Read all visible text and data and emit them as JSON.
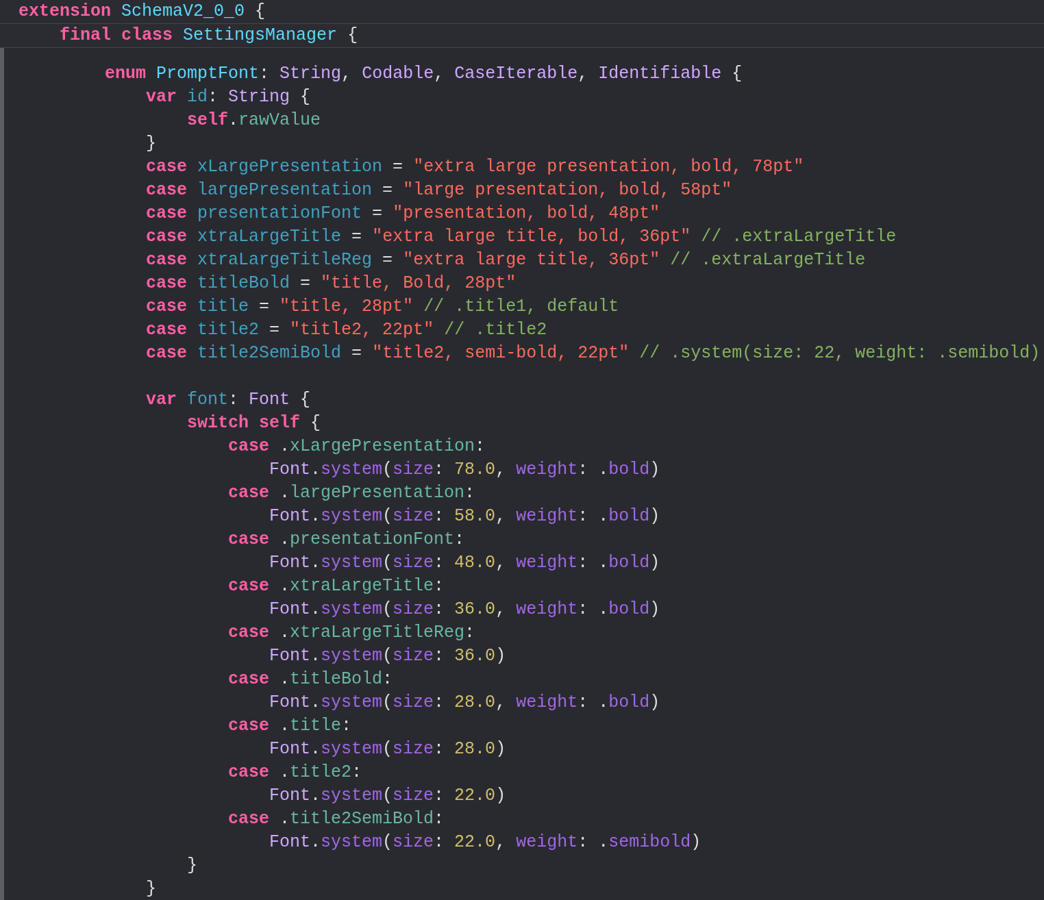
{
  "sticky_header": [
    {
      "kind": "code",
      "words": [
        [
          {
            "kind": "keyword",
            "text": "extension"
          }
        ],
        [
          {
            "kind": "decl",
            "text": "SchemaV2_0_0"
          }
        ],
        [
          {
            "kind": "punct",
            "text": "{"
          }
        ]
      ],
      "children": [
        {
          "kind": "code",
          "words": [
            [
              {
                "kind": "keyword",
                "text": "final"
              }
            ],
            [
              {
                "kind": "keyword",
                "text": "class"
              }
            ],
            [
              {
                "kind": "decl",
                "text": "SettingsManager"
              }
            ],
            [
              {
                "kind": "punct",
                "text": "{"
              }
            ]
          ]
        }
      ]
    }
  ],
  "code_lines": [
    {
      "kind": "code",
      "words": [
        [
          {
            "kind": "keyword",
            "text": "enum"
          }
        ],
        [
          {
            "kind": "decl",
            "text": "PromptFont"
          },
          {
            "kind": "punct",
            "text": ":"
          }
        ],
        [
          {
            "kind": "type",
            "text": "String"
          },
          {
            "kind": "punct",
            "text": ","
          }
        ],
        [
          {
            "kind": "type",
            "text": "Codable"
          },
          {
            "kind": "punct",
            "text": ","
          }
        ],
        [
          {
            "kind": "type",
            "text": "CaseIterable"
          },
          {
            "kind": "punct",
            "text": ","
          }
        ],
        [
          {
            "kind": "type",
            "text": "Identifiable"
          }
        ],
        [
          {
            "kind": "punct",
            "text": "{"
          }
        ]
      ],
      "children": [
        {
          "kind": "code",
          "words": [
            [
              {
                "kind": "keyword",
                "text": "var"
              }
            ],
            [
              {
                "kind": "ident",
                "text": "id"
              },
              {
                "kind": "punct",
                "text": ":"
              }
            ],
            [
              {
                "kind": "type",
                "text": "String"
              }
            ],
            [
              {
                "kind": "punct",
                "text": "{"
              }
            ]
          ],
          "children": [
            {
              "kind": "code",
              "words": [
                [
                  {
                    "kind": "keyword",
                    "text": "self"
                  },
                  {
                    "kind": "punct",
                    "text": "."
                  },
                  {
                    "kind": "member",
                    "text": "rawValue"
                  }
                ]
              ]
            }
          ]
        },
        {
          "kind": "code",
          "words": [
            [
              {
                "kind": "punct",
                "text": "}"
              }
            ]
          ]
        },
        {
          "kind": "code",
          "words": [
            [
              {
                "kind": "keyword",
                "text": "case"
              }
            ],
            [
              {
                "kind": "ident",
                "text": "xLargePresentation"
              }
            ],
            [
              {
                "kind": "punct",
                "text": "="
              }
            ],
            [
              {
                "kind": "string",
                "text": "\"extra large presentation, bold, 78pt\""
              }
            ]
          ]
        },
        {
          "kind": "code",
          "words": [
            [
              {
                "kind": "keyword",
                "text": "case"
              }
            ],
            [
              {
                "kind": "ident",
                "text": "largePresentation"
              }
            ],
            [
              {
                "kind": "punct",
                "text": "="
              }
            ],
            [
              {
                "kind": "string",
                "text": "\"large presentation, bold, 58pt\""
              }
            ]
          ]
        },
        {
          "kind": "code",
          "words": [
            [
              {
                "kind": "keyword",
                "text": "case"
              }
            ],
            [
              {
                "kind": "ident",
                "text": "presentationFont"
              }
            ],
            [
              {
                "kind": "punct",
                "text": "="
              }
            ],
            [
              {
                "kind": "string",
                "text": "\"presentation, bold, 48pt\""
              }
            ]
          ]
        },
        {
          "kind": "code",
          "words": [
            [
              {
                "kind": "keyword",
                "text": "case"
              }
            ],
            [
              {
                "kind": "ident",
                "text": "xtraLargeTitle"
              }
            ],
            [
              {
                "kind": "punct",
                "text": "="
              }
            ],
            [
              {
                "kind": "string",
                "text": "\"extra large title, bold, 36pt\""
              }
            ],
            [
              {
                "kind": "comment",
                "text": "// .extraLargeTitle"
              }
            ]
          ]
        },
        {
          "kind": "code",
          "words": [
            [
              {
                "kind": "keyword",
                "text": "case"
              }
            ],
            [
              {
                "kind": "ident",
                "text": "xtraLargeTitleReg"
              }
            ],
            [
              {
                "kind": "punct",
                "text": "="
              }
            ],
            [
              {
                "kind": "string",
                "text": "\"extra large title, 36pt\""
              }
            ],
            [
              {
                "kind": "comment",
                "text": "// .extraLargeTitle"
              }
            ]
          ]
        },
        {
          "kind": "code",
          "words": [
            [
              {
                "kind": "keyword",
                "text": "case"
              }
            ],
            [
              {
                "kind": "ident",
                "text": "titleBold"
              }
            ],
            [
              {
                "kind": "punct",
                "text": "="
              }
            ],
            [
              {
                "kind": "string",
                "text": "\"title, Bold, 28pt\""
              }
            ]
          ]
        },
        {
          "kind": "code",
          "words": [
            [
              {
                "kind": "keyword",
                "text": "case"
              }
            ],
            [
              {
                "kind": "ident",
                "text": "title"
              }
            ],
            [
              {
                "kind": "punct",
                "text": "="
              }
            ],
            [
              {
                "kind": "string",
                "text": "\"title, 28pt\""
              }
            ],
            [
              {
                "kind": "comment",
                "text": "// .title1, default"
              }
            ]
          ]
        },
        {
          "kind": "code",
          "words": [
            [
              {
                "kind": "keyword",
                "text": "case"
              }
            ],
            [
              {
                "kind": "ident",
                "text": "title2"
              }
            ],
            [
              {
                "kind": "punct",
                "text": "="
              }
            ],
            [
              {
                "kind": "string",
                "text": "\"title2, 22pt\""
              }
            ],
            [
              {
                "kind": "comment",
                "text": "// .title2"
              }
            ]
          ]
        },
        {
          "kind": "code",
          "words": [
            [
              {
                "kind": "keyword",
                "text": "case"
              }
            ],
            [
              {
                "kind": "ident",
                "text": "title2SemiBold"
              }
            ],
            [
              {
                "kind": "punct",
                "text": "="
              }
            ],
            [
              {
                "kind": "string",
                "text": "\"title2, semi-bold, 22pt\""
              }
            ],
            [
              {
                "kind": "comment",
                "text": "// .system(size: 22, weight: .semibold)"
              }
            ]
          ]
        },
        {
          "kind": "blank"
        },
        {
          "kind": "code",
          "words": [
            [
              {
                "kind": "keyword",
                "text": "var"
              }
            ],
            [
              {
                "kind": "ident",
                "text": "font"
              },
              {
                "kind": "punct",
                "text": ":"
              }
            ],
            [
              {
                "kind": "type",
                "text": "Font"
              }
            ],
            [
              {
                "kind": "punct",
                "text": "{"
              }
            ]
          ],
          "children": [
            {
              "kind": "code",
              "words": [
                [
                  {
                    "kind": "keyword",
                    "text": "switch"
                  }
                ],
                [
                  {
                    "kind": "keyword",
                    "text": "self"
                  }
                ],
                [
                  {
                    "kind": "punct",
                    "text": "{"
                  }
                ]
              ],
              "children": [
                {
                  "kind": "code",
                  "words": [
                    [
                      {
                        "kind": "keyword",
                        "text": "case"
                      }
                    ],
                    [
                      {
                        "kind": "punct",
                        "text": "."
                      },
                      {
                        "kind": "member",
                        "text": "xLargePresentation"
                      },
                      {
                        "kind": "punct",
                        "text": ":"
                      }
                    ]
                  ],
                  "children": [
                    {
                      "kind": "code",
                      "words": [
                        [
                          {
                            "kind": "type",
                            "text": "Font"
                          },
                          {
                            "kind": "punct",
                            "text": "."
                          },
                          {
                            "kind": "system",
                            "text": "system"
                          },
                          {
                            "kind": "punct",
                            "text": "("
                          },
                          {
                            "kind": "system",
                            "text": "size"
                          },
                          {
                            "kind": "punct",
                            "text": ":"
                          }
                        ],
                        [
                          {
                            "kind": "number",
                            "text": "78.0"
                          },
                          {
                            "kind": "punct",
                            "text": ","
                          }
                        ],
                        [
                          {
                            "kind": "system",
                            "text": "weight"
                          },
                          {
                            "kind": "punct",
                            "text": ":"
                          }
                        ],
                        [
                          {
                            "kind": "punct",
                            "text": "."
                          },
                          {
                            "kind": "system",
                            "text": "bold"
                          },
                          {
                            "kind": "punct",
                            "text": ")"
                          }
                        ]
                      ]
                    }
                  ]
                },
                {
                  "kind": "code",
                  "words": [
                    [
                      {
                        "kind": "keyword",
                        "text": "case"
                      }
                    ],
                    [
                      {
                        "kind": "punct",
                        "text": "."
                      },
                      {
                        "kind": "member",
                        "text": "largePresentation"
                      },
                      {
                        "kind": "punct",
                        "text": ":"
                      }
                    ]
                  ],
                  "children": [
                    {
                      "kind": "code",
                      "words": [
                        [
                          {
                            "kind": "type",
                            "text": "Font"
                          },
                          {
                            "kind": "punct",
                            "text": "."
                          },
                          {
                            "kind": "system",
                            "text": "system"
                          },
                          {
                            "kind": "punct",
                            "text": "("
                          },
                          {
                            "kind": "system",
                            "text": "size"
                          },
                          {
                            "kind": "punct",
                            "text": ":"
                          }
                        ],
                        [
                          {
                            "kind": "number",
                            "text": "58.0"
                          },
                          {
                            "kind": "punct",
                            "text": ","
                          }
                        ],
                        [
                          {
                            "kind": "system",
                            "text": "weight"
                          },
                          {
                            "kind": "punct",
                            "text": ":"
                          }
                        ],
                        [
                          {
                            "kind": "punct",
                            "text": "."
                          },
                          {
                            "kind": "system",
                            "text": "bold"
                          },
                          {
                            "kind": "punct",
                            "text": ")"
                          }
                        ]
                      ]
                    }
                  ]
                },
                {
                  "kind": "code",
                  "words": [
                    [
                      {
                        "kind": "keyword",
                        "text": "case"
                      }
                    ],
                    [
                      {
                        "kind": "punct",
                        "text": "."
                      },
                      {
                        "kind": "member",
                        "text": "presentationFont"
                      },
                      {
                        "kind": "punct",
                        "text": ":"
                      }
                    ]
                  ],
                  "children": [
                    {
                      "kind": "code",
                      "words": [
                        [
                          {
                            "kind": "type",
                            "text": "Font"
                          },
                          {
                            "kind": "punct",
                            "text": "."
                          },
                          {
                            "kind": "system",
                            "text": "system"
                          },
                          {
                            "kind": "punct",
                            "text": "("
                          },
                          {
                            "kind": "system",
                            "text": "size"
                          },
                          {
                            "kind": "punct",
                            "text": ":"
                          }
                        ],
                        [
                          {
                            "kind": "number",
                            "text": "48.0"
                          },
                          {
                            "kind": "punct",
                            "text": ","
                          }
                        ],
                        [
                          {
                            "kind": "system",
                            "text": "weight"
                          },
                          {
                            "kind": "punct",
                            "text": ":"
                          }
                        ],
                        [
                          {
                            "kind": "punct",
                            "text": "."
                          },
                          {
                            "kind": "system",
                            "text": "bold"
                          },
                          {
                            "kind": "punct",
                            "text": ")"
                          }
                        ]
                      ]
                    }
                  ]
                },
                {
                  "kind": "code",
                  "words": [
                    [
                      {
                        "kind": "keyword",
                        "text": "case"
                      }
                    ],
                    [
                      {
                        "kind": "punct",
                        "text": "."
                      },
                      {
                        "kind": "member",
                        "text": "xtraLargeTitle"
                      },
                      {
                        "kind": "punct",
                        "text": ":"
                      }
                    ]
                  ],
                  "children": [
                    {
                      "kind": "code",
                      "words": [
                        [
                          {
                            "kind": "type",
                            "text": "Font"
                          },
                          {
                            "kind": "punct",
                            "text": "."
                          },
                          {
                            "kind": "system",
                            "text": "system"
                          },
                          {
                            "kind": "punct",
                            "text": "("
                          },
                          {
                            "kind": "system",
                            "text": "size"
                          },
                          {
                            "kind": "punct",
                            "text": ":"
                          }
                        ],
                        [
                          {
                            "kind": "number",
                            "text": "36.0"
                          },
                          {
                            "kind": "punct",
                            "text": ","
                          }
                        ],
                        [
                          {
                            "kind": "system",
                            "text": "weight"
                          },
                          {
                            "kind": "punct",
                            "text": ":"
                          }
                        ],
                        [
                          {
                            "kind": "punct",
                            "text": "."
                          },
                          {
                            "kind": "system",
                            "text": "bold"
                          },
                          {
                            "kind": "punct",
                            "text": ")"
                          }
                        ]
                      ]
                    }
                  ]
                },
                {
                  "kind": "code",
                  "words": [
                    [
                      {
                        "kind": "keyword",
                        "text": "case"
                      }
                    ],
                    [
                      {
                        "kind": "punct",
                        "text": "."
                      },
                      {
                        "kind": "member",
                        "text": "xtraLargeTitleReg"
                      },
                      {
                        "kind": "punct",
                        "text": ":"
                      }
                    ]
                  ],
                  "children": [
                    {
                      "kind": "code",
                      "words": [
                        [
                          {
                            "kind": "type",
                            "text": "Font"
                          },
                          {
                            "kind": "punct",
                            "text": "."
                          },
                          {
                            "kind": "system",
                            "text": "system"
                          },
                          {
                            "kind": "punct",
                            "text": "("
                          },
                          {
                            "kind": "system",
                            "text": "size"
                          },
                          {
                            "kind": "punct",
                            "text": ":"
                          }
                        ],
                        [
                          {
                            "kind": "number",
                            "text": "36.0"
                          },
                          {
                            "kind": "punct",
                            "text": ")"
                          }
                        ]
                      ]
                    }
                  ]
                },
                {
                  "kind": "code",
                  "words": [
                    [
                      {
                        "kind": "keyword",
                        "text": "case"
                      }
                    ],
                    [
                      {
                        "kind": "punct",
                        "text": "."
                      },
                      {
                        "kind": "member",
                        "text": "titleBold"
                      },
                      {
                        "kind": "punct",
                        "text": ":"
                      }
                    ]
                  ],
                  "children": [
                    {
                      "kind": "code",
                      "words": [
                        [
                          {
                            "kind": "type",
                            "text": "Font"
                          },
                          {
                            "kind": "punct",
                            "text": "."
                          },
                          {
                            "kind": "system",
                            "text": "system"
                          },
                          {
                            "kind": "punct",
                            "text": "("
                          },
                          {
                            "kind": "system",
                            "text": "size"
                          },
                          {
                            "kind": "punct",
                            "text": ":"
                          }
                        ],
                        [
                          {
                            "kind": "number",
                            "text": "28.0"
                          },
                          {
                            "kind": "punct",
                            "text": ","
                          }
                        ],
                        [
                          {
                            "kind": "system",
                            "text": "weight"
                          },
                          {
                            "kind": "punct",
                            "text": ":"
                          }
                        ],
                        [
                          {
                            "kind": "punct",
                            "text": "."
                          },
                          {
                            "kind": "system",
                            "text": "bold"
                          },
                          {
                            "kind": "punct",
                            "text": ")"
                          }
                        ]
                      ]
                    }
                  ]
                },
                {
                  "kind": "code",
                  "words": [
                    [
                      {
                        "kind": "keyword",
                        "text": "case"
                      }
                    ],
                    [
                      {
                        "kind": "punct",
                        "text": "."
                      },
                      {
                        "kind": "member",
                        "text": "title"
                      },
                      {
                        "kind": "punct",
                        "text": ":"
                      }
                    ]
                  ],
                  "children": [
                    {
                      "kind": "code",
                      "words": [
                        [
                          {
                            "kind": "type",
                            "text": "Font"
                          },
                          {
                            "kind": "punct",
                            "text": "."
                          },
                          {
                            "kind": "system",
                            "text": "system"
                          },
                          {
                            "kind": "punct",
                            "text": "("
                          },
                          {
                            "kind": "system",
                            "text": "size"
                          },
                          {
                            "kind": "punct",
                            "text": ":"
                          }
                        ],
                        [
                          {
                            "kind": "number",
                            "text": "28.0"
                          },
                          {
                            "kind": "punct",
                            "text": ")"
                          }
                        ]
                      ]
                    }
                  ]
                },
                {
                  "kind": "code",
                  "words": [
                    [
                      {
                        "kind": "keyword",
                        "text": "case"
                      }
                    ],
                    [
                      {
                        "kind": "punct",
                        "text": "."
                      },
                      {
                        "kind": "member",
                        "text": "title2"
                      },
                      {
                        "kind": "punct",
                        "text": ":"
                      }
                    ]
                  ],
                  "children": [
                    {
                      "kind": "code",
                      "words": [
                        [
                          {
                            "kind": "type",
                            "text": "Font"
                          },
                          {
                            "kind": "punct",
                            "text": "."
                          },
                          {
                            "kind": "system",
                            "text": "system"
                          },
                          {
                            "kind": "punct",
                            "text": "("
                          },
                          {
                            "kind": "system",
                            "text": "size"
                          },
                          {
                            "kind": "punct",
                            "text": ":"
                          }
                        ],
                        [
                          {
                            "kind": "number",
                            "text": "22.0"
                          },
                          {
                            "kind": "punct",
                            "text": ")"
                          }
                        ]
                      ]
                    }
                  ]
                },
                {
                  "kind": "code",
                  "words": [
                    [
                      {
                        "kind": "keyword",
                        "text": "case"
                      }
                    ],
                    [
                      {
                        "kind": "punct",
                        "text": "."
                      },
                      {
                        "kind": "member",
                        "text": "title2SemiBold"
                      },
                      {
                        "kind": "punct",
                        "text": ":"
                      }
                    ]
                  ],
                  "children": [
                    {
                      "kind": "code",
                      "words": [
                        [
                          {
                            "kind": "type",
                            "text": "Font"
                          },
                          {
                            "kind": "punct",
                            "text": "."
                          },
                          {
                            "kind": "system",
                            "text": "system"
                          },
                          {
                            "kind": "punct",
                            "text": "("
                          },
                          {
                            "kind": "system",
                            "text": "size"
                          },
                          {
                            "kind": "punct",
                            "text": ":"
                          }
                        ],
                        [
                          {
                            "kind": "number",
                            "text": "22.0"
                          },
                          {
                            "kind": "punct",
                            "text": ","
                          }
                        ],
                        [
                          {
                            "kind": "system",
                            "text": "weight"
                          },
                          {
                            "kind": "punct",
                            "text": ":"
                          }
                        ],
                        [
                          {
                            "kind": "punct",
                            "text": "."
                          },
                          {
                            "kind": "system",
                            "text": "semibold"
                          },
                          {
                            "kind": "punct",
                            "text": ")"
                          }
                        ]
                      ]
                    }
                  ]
                }
              ]
            },
            {
              "kind": "code",
              "words": [
                [
                  {
                    "kind": "punct",
                    "text": "}"
                  }
                ]
              ]
            }
          ]
        },
        {
          "kind": "code",
          "words": [
            [
              {
                "kind": "punct",
                "text": "}"
              }
            ]
          ]
        }
      ]
    }
  ]
}
